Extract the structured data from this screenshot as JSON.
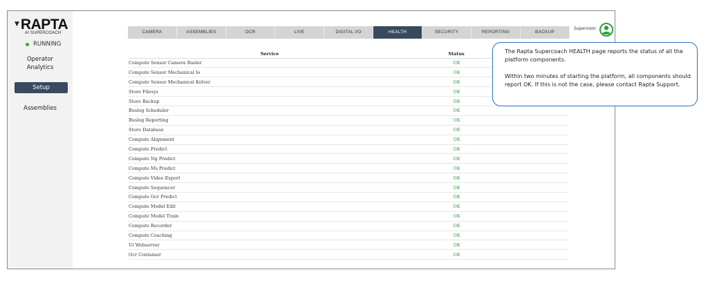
{
  "brand": {
    "name": "RAPTA",
    "tagline": "AI SUPERCOACH",
    "status": "RUNNING",
    "status_color": "#3ea34a"
  },
  "sidebar": {
    "items": [
      {
        "label": "Operator\nAnalytics",
        "active": false
      },
      {
        "label": "Setup",
        "active": true
      },
      {
        "label": "Assemblies",
        "active": false
      }
    ]
  },
  "tabs": [
    {
      "label": "CAMERA",
      "active": false
    },
    {
      "label": "ASSEMBLIES",
      "active": false
    },
    {
      "label": "OCR",
      "active": false
    },
    {
      "label": "LIVE",
      "active": false
    },
    {
      "label": "DIGITAL I/O",
      "active": false
    },
    {
      "label": "HEALTH",
      "active": true
    },
    {
      "label": "SECURITY",
      "active": false
    },
    {
      "label": "REPORTING",
      "active": false
    },
    {
      "label": "BACKUP",
      "active": false
    }
  ],
  "user": {
    "role": "Supervisor",
    "icon": "user-avatar-icon"
  },
  "table": {
    "headers": [
      "Service",
      "Status"
    ],
    "rows": [
      {
        "service": "Compute Sensor Camera Basler",
        "status": "OK"
      },
      {
        "service": "Compute Sensor Mechanical Io",
        "status": "OK"
      },
      {
        "service": "Compute Sensor Mechanical Kolver",
        "status": "OK"
      },
      {
        "service": "Store Filesys",
        "status": "OK"
      },
      {
        "service": "Store Backup",
        "status": "OK"
      },
      {
        "service": "Buslog Scheduler",
        "status": "OK"
      },
      {
        "service": "Buslog Reporting",
        "status": "OK"
      },
      {
        "service": "Store Database",
        "status": "OK"
      },
      {
        "service": "Compute Alignment",
        "status": "OK"
      },
      {
        "service": "Compute Predict",
        "status": "OK"
      },
      {
        "service": "Compute Ng Predict",
        "status": "OK"
      },
      {
        "service": "Compute Ms Predict",
        "status": "OK"
      },
      {
        "service": "Compute Video Export",
        "status": "OK"
      },
      {
        "service": "Compute Sequencer",
        "status": "OK"
      },
      {
        "service": "Compute Ocr Predict",
        "status": "OK"
      },
      {
        "service": "Compute Model Edit",
        "status": "OK"
      },
      {
        "service": "Compute Model Train",
        "status": "OK"
      },
      {
        "service": "Compute Recorder",
        "status": "OK"
      },
      {
        "service": "Compute Coaching",
        "status": "OK"
      },
      {
        "service": "Ui Webserver",
        "status": "OK"
      },
      {
        "service": "Ocr Container",
        "status": "OK"
      }
    ],
    "ok_color": "#2e9e3c"
  },
  "callout": {
    "paragraph1": "The Rapta Supercoach HEALTH page reports the status of all the platform components.",
    "paragraph2": "Within two minutes of starting the platform, all components should report OK. If this is not the case, please contact Rapta Support.",
    "border_color": "#2b6cc4"
  },
  "colors": {
    "nav_active": "#374a5e",
    "tab_inactive": "#d4d4d4",
    "sidebar_bg": "#f2f2f2"
  }
}
